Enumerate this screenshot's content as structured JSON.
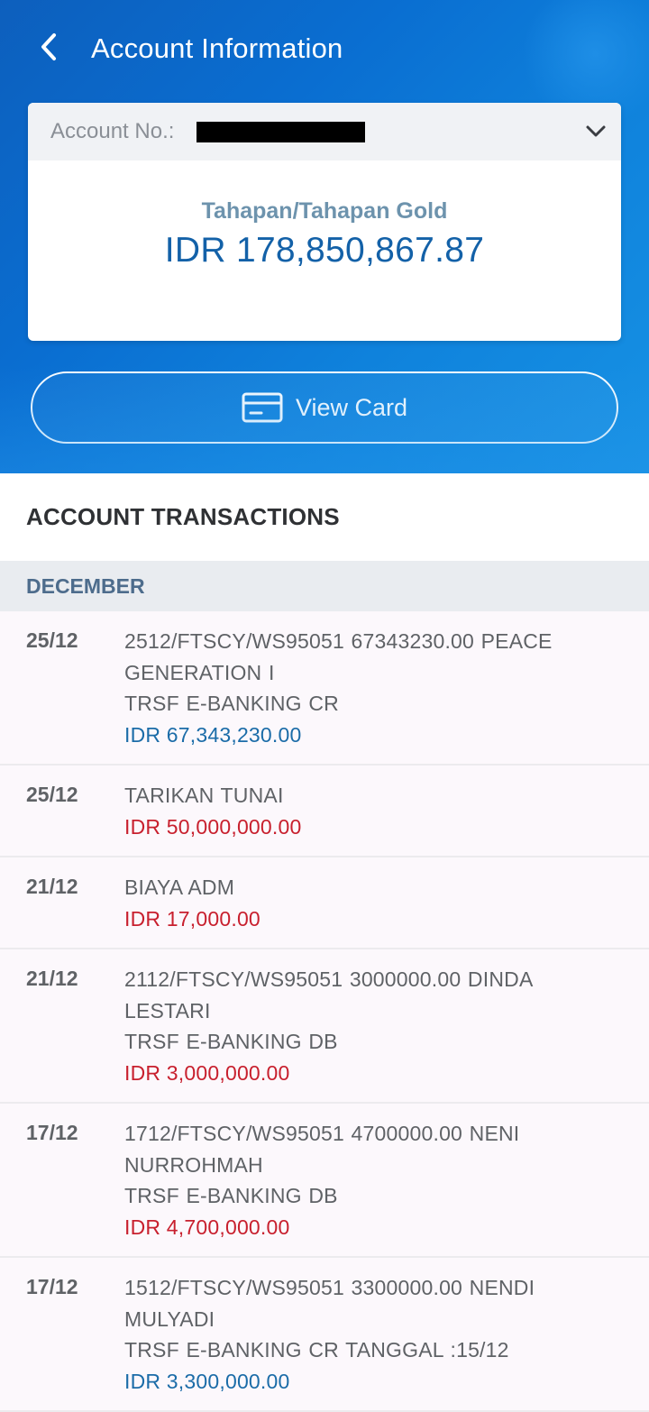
{
  "header": {
    "title": "Account Information",
    "back_icon": "chevron-left-icon"
  },
  "account": {
    "label": "Account No.:",
    "number_redacted": true,
    "product": "Tahapan/Tahapan Gold",
    "balance": "IDR 178,850,867.87"
  },
  "view_card": {
    "label": "View Card",
    "icon": "card-icon"
  },
  "transactions": {
    "section_title": "ACCOUNT TRANSACTIONS",
    "month": "DECEMBER",
    "items": [
      {
        "date": "25/12",
        "lines": [
          "2512/FTSCY/WS95051 67343230.00 PEACE",
          "GENERATION I",
          "TRSF E-BANKING CR"
        ],
        "amount": "IDR 67,343,230.00",
        "type": "credit"
      },
      {
        "date": "25/12",
        "lines": [
          "TARIKAN TUNAI"
        ],
        "amount": "IDR 50,000,000.00",
        "type": "debit"
      },
      {
        "date": "21/12",
        "lines": [
          "BIAYA ADM"
        ],
        "amount": "IDR 17,000.00",
        "type": "debit"
      },
      {
        "date": "21/12",
        "lines": [
          "2112/FTSCY/WS95051  3000000.00 DINDA",
          "LESTARI",
          "TRSF E-BANKING DB"
        ],
        "amount": "IDR 3,000,000.00",
        "type": "debit"
      },
      {
        "date": "17/12",
        "lines": [
          "1712/FTSCY/WS95051 4700000.00 NENI",
          "NURROHMAH",
          "TRSF E-BANKING DB"
        ],
        "amount": "IDR 4,700,000.00",
        "type": "debit"
      },
      {
        "date": "17/12",
        "lines": [
          "1512/FTSCY/WS95051 3300000.00 NENDI",
          "MULYADI",
          "TRSF E-BANKING CR TANGGAL :15/12"
        ],
        "amount": "IDR 3,300,000.00",
        "type": "credit"
      }
    ]
  },
  "colors": {
    "header_blue": "#0a6ed1",
    "balance_blue": "#1361a8",
    "credit": "#1b6ca8",
    "debit": "#c8202e"
  }
}
